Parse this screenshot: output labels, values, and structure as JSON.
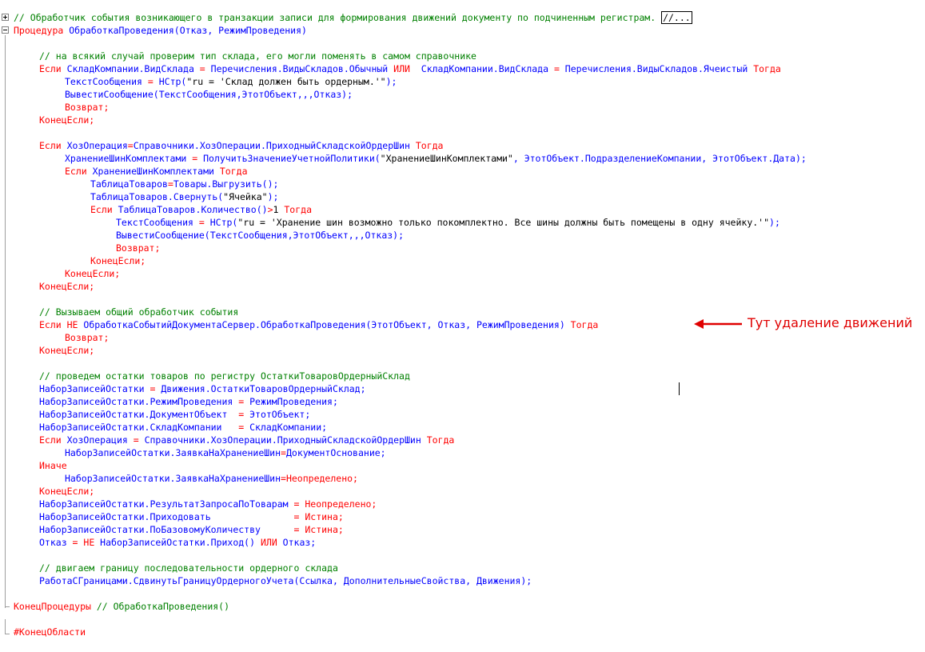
{
  "colors": {
    "keyword": "#ff0000",
    "comment": "#008000",
    "identifier": "#0000ff",
    "string": "#000000",
    "annotation": "#e00000"
  },
  "code": {
    "lines": [
      {
        "indent": 0,
        "tokens": [
          {
            "t": "// Обработчик события возникающего в транзакции записи для формирования движений документу по подчиненным регистрам. ",
            "c": "c"
          },
          {
            "t": "//...",
            "c": "fold"
          }
        ]
      },
      {
        "indent": 0,
        "tokens": [
          {
            "t": "Процедура",
            "c": "k"
          },
          {
            "t": " ОбработкаПроведения(Отказ, РежимПроведения)",
            "c": "i"
          }
        ]
      },
      {
        "indent": 0,
        "tokens": []
      },
      {
        "indent": 1,
        "tokens": [
          {
            "t": "// на всякий случай проверим тип склада, его могли поменять в самом справочнике",
            "c": "c"
          }
        ]
      },
      {
        "indent": 1,
        "tokens": [
          {
            "t": "Если",
            "c": "k"
          },
          {
            "t": " СкладКомпании.ВидСклада ",
            "c": "i"
          },
          {
            "t": "=",
            "c": "k"
          },
          {
            "t": " Перечисления.ВидыСкладов.Обычный ",
            "c": "i"
          },
          {
            "t": "ИЛИ",
            "c": "k"
          },
          {
            "t": "  СкладКомпании.ВидСклада ",
            "c": "i"
          },
          {
            "t": "=",
            "c": "k"
          },
          {
            "t": " Перечисления.ВидыСкладов.Ячеистый ",
            "c": "i"
          },
          {
            "t": "Тогда",
            "c": "k"
          }
        ]
      },
      {
        "indent": 2,
        "tokens": [
          {
            "t": "ТекстСообщения ",
            "c": "i"
          },
          {
            "t": "=",
            "c": "k"
          },
          {
            "t": " НСтр(",
            "c": "i"
          },
          {
            "t": "\"ru = 'Склад должен быть ордерным.'\"",
            "c": "s"
          },
          {
            "t": ");",
            "c": "i"
          }
        ]
      },
      {
        "indent": 2,
        "tokens": [
          {
            "t": "ВывестиСообщение(ТекстСообщения,ЭтотОбъект,,,Отказ);",
            "c": "i"
          }
        ]
      },
      {
        "indent": 2,
        "tokens": [
          {
            "t": "Возврат;",
            "c": "k"
          }
        ]
      },
      {
        "indent": 1,
        "tokens": [
          {
            "t": "КонецЕсли;",
            "c": "k"
          }
        ]
      },
      {
        "indent": 0,
        "tokens": []
      },
      {
        "indent": 1,
        "tokens": [
          {
            "t": "Если",
            "c": "k"
          },
          {
            "t": " ХозОперация",
            "c": "i"
          },
          {
            "t": "=",
            "c": "k"
          },
          {
            "t": "Справочники.ХозОперации.ПриходныйСкладскойОрдерШин ",
            "c": "i"
          },
          {
            "t": "Тогда",
            "c": "k"
          }
        ]
      },
      {
        "indent": 2,
        "tokens": [
          {
            "t": "ХранениеШинКомплектами ",
            "c": "i"
          },
          {
            "t": "=",
            "c": "k"
          },
          {
            "t": " ПолучитьЗначениеУчетнойПолитики(",
            "c": "i"
          },
          {
            "t": "\"ХранениеШинКомплектами\"",
            "c": "s"
          },
          {
            "t": ", ЭтотОбъект.ПодразделениеКомпании, ЭтотОбъект.Дата);",
            "c": "i"
          }
        ]
      },
      {
        "indent": 2,
        "tokens": [
          {
            "t": "Если",
            "c": "k"
          },
          {
            "t": " ХранениеШинКомплектами ",
            "c": "i"
          },
          {
            "t": "Тогда",
            "c": "k"
          }
        ]
      },
      {
        "indent": 3,
        "tokens": [
          {
            "t": "ТаблицаТоваров",
            "c": "i"
          },
          {
            "t": "=",
            "c": "k"
          },
          {
            "t": "Товары.Выгрузить();",
            "c": "i"
          }
        ]
      },
      {
        "indent": 3,
        "tokens": [
          {
            "t": "ТаблицаТоваров.Свернуть(",
            "c": "i"
          },
          {
            "t": "\"Ячейка\"",
            "c": "s"
          },
          {
            "t": ");",
            "c": "i"
          }
        ]
      },
      {
        "indent": 3,
        "tokens": [
          {
            "t": "Если",
            "c": "k"
          },
          {
            "t": " ТаблицаТоваров.Количество()",
            "c": "i"
          },
          {
            "t": ">",
            "c": "k"
          },
          {
            "t": "1 ",
            "c": "s"
          },
          {
            "t": "Тогда",
            "c": "k"
          }
        ]
      },
      {
        "indent": 4,
        "tokens": [
          {
            "t": "ТекстСообщения ",
            "c": "i"
          },
          {
            "t": "=",
            "c": "k"
          },
          {
            "t": " НСтр(",
            "c": "i"
          },
          {
            "t": "\"ru = 'Хранение шин возможно только покомплектно. Все шины должны быть помещены в одну ячейку.'\"",
            "c": "s"
          },
          {
            "t": ");",
            "c": "i"
          }
        ]
      },
      {
        "indent": 4,
        "tokens": [
          {
            "t": "ВывестиСообщение(ТекстСообщения,ЭтотОбъект,,,Отказ);",
            "c": "i"
          }
        ]
      },
      {
        "indent": 4,
        "tokens": [
          {
            "t": "Возврат;",
            "c": "k"
          }
        ]
      },
      {
        "indent": 3,
        "tokens": [
          {
            "t": "КонецЕсли;",
            "c": "k"
          }
        ]
      },
      {
        "indent": 2,
        "tokens": [
          {
            "t": "КонецЕсли;",
            "c": "k"
          }
        ]
      },
      {
        "indent": 1,
        "tokens": [
          {
            "t": "КонецЕсли;",
            "c": "k"
          }
        ]
      },
      {
        "indent": 0,
        "tokens": []
      },
      {
        "indent": 1,
        "tokens": [
          {
            "t": "// Вызываем общий обработчик события",
            "c": "c"
          }
        ]
      },
      {
        "indent": 1,
        "tokens": [
          {
            "t": "Если НЕ",
            "c": "k"
          },
          {
            "t": " ОбработкаСобытийДокументаСервер.ОбработкаПроведения(ЭтотОбъект, Отказ, РежимПроведения) ",
            "c": "i"
          },
          {
            "t": "Тогда",
            "c": "k"
          }
        ]
      },
      {
        "indent": 2,
        "tokens": [
          {
            "t": "Возврат;",
            "c": "k"
          }
        ]
      },
      {
        "indent": 1,
        "tokens": [
          {
            "t": "КонецЕсли;",
            "c": "k"
          }
        ]
      },
      {
        "indent": 0,
        "tokens": []
      },
      {
        "indent": 1,
        "tokens": [
          {
            "t": "// проведем остатки товаров по регистру ОстаткиТоваровОрдерныйСклад",
            "c": "c"
          }
        ]
      },
      {
        "indent": 1,
        "tokens": [
          {
            "t": "НаборЗаписейОстатки ",
            "c": "i"
          },
          {
            "t": "=",
            "c": "k"
          },
          {
            "t": " Движения.ОстаткиТоваровОрдерныйСклад;",
            "c": "i"
          }
        ]
      },
      {
        "indent": 1,
        "tokens": [
          {
            "t": "НаборЗаписейОстатки.РежимПроведения ",
            "c": "i"
          },
          {
            "t": "=",
            "c": "k"
          },
          {
            "t": " РежимПроведения;",
            "c": "i"
          }
        ]
      },
      {
        "indent": 1,
        "tokens": [
          {
            "t": "НаборЗаписейОстатки.ДокументОбъект  ",
            "c": "i"
          },
          {
            "t": "=",
            "c": "k"
          },
          {
            "t": " ЭтотОбъект;",
            "c": "i"
          }
        ]
      },
      {
        "indent": 1,
        "tokens": [
          {
            "t": "НаборЗаписейОстатки.СкладКомпании   ",
            "c": "i"
          },
          {
            "t": "=",
            "c": "k"
          },
          {
            "t": " СкладКомпании;",
            "c": "i"
          }
        ]
      },
      {
        "indent": 1,
        "tokens": [
          {
            "t": "Если",
            "c": "k"
          },
          {
            "t": " ХозОперация ",
            "c": "i"
          },
          {
            "t": "=",
            "c": "k"
          },
          {
            "t": " Справочники.ХозОперации.ПриходныйСкладскойОрдерШин ",
            "c": "i"
          },
          {
            "t": "Тогда",
            "c": "k"
          }
        ]
      },
      {
        "indent": 2,
        "tokens": [
          {
            "t": "НаборЗаписейОстатки.ЗаявкаНаХранениеШин",
            "c": "i"
          },
          {
            "t": "=",
            "c": "k"
          },
          {
            "t": "ДокументОснование;",
            "c": "i"
          }
        ]
      },
      {
        "indent": 1,
        "tokens": [
          {
            "t": "Иначе",
            "c": "k"
          }
        ]
      },
      {
        "indent": 2,
        "tokens": [
          {
            "t": "НаборЗаписейОстатки.ЗаявкаНаХранениеШин",
            "c": "i"
          },
          {
            "t": "=Неопределено;",
            "c": "k"
          }
        ]
      },
      {
        "indent": 1,
        "tokens": [
          {
            "t": "КонецЕсли;",
            "c": "k"
          }
        ]
      },
      {
        "indent": 1,
        "tokens": [
          {
            "t": "НаборЗаписейОстатки.РезультатЗапросаПоТоварам ",
            "c": "i"
          },
          {
            "t": "= Неопределено;",
            "c": "k"
          }
        ]
      },
      {
        "indent": 1,
        "tokens": [
          {
            "t": "НаборЗаписейОстатки.Приходовать               ",
            "c": "i"
          },
          {
            "t": "= Истина;",
            "c": "k"
          }
        ]
      },
      {
        "indent": 1,
        "tokens": [
          {
            "t": "НаборЗаписейОстатки.ПоБазовомуКоличеству      ",
            "c": "i"
          },
          {
            "t": "= Истина;",
            "c": "k"
          }
        ]
      },
      {
        "indent": 1,
        "tokens": [
          {
            "t": "Отказ ",
            "c": "i"
          },
          {
            "t": "= НЕ",
            "c": "k"
          },
          {
            "t": " НаборЗаписейОстатки.Приход() ",
            "c": "i"
          },
          {
            "t": "ИЛИ",
            "c": "k"
          },
          {
            "t": " Отказ;",
            "c": "i"
          }
        ]
      },
      {
        "indent": 0,
        "tokens": []
      },
      {
        "indent": 1,
        "tokens": [
          {
            "t": "// двигаем границу последовательности ордерного склада",
            "c": "c"
          }
        ]
      },
      {
        "indent": 1,
        "tokens": [
          {
            "t": "РаботаСГраницами.СдвинутьГраницуОрдерногоУчета(Ссылка, ДополнительныеСвойства, Движения);",
            "c": "i"
          }
        ]
      },
      {
        "indent": 0,
        "tokens": []
      },
      {
        "indent": 0,
        "tokens": [
          {
            "t": "КонецПроцедуры",
            "c": "k"
          },
          {
            "t": " // ОбработкаПроведения()",
            "c": "c"
          }
        ]
      },
      {
        "indent": 0,
        "tokens": []
      },
      {
        "indent": 0,
        "tokens": [
          {
            "t": "#КонецОбласти",
            "c": "k"
          }
        ]
      }
    ]
  },
  "annotation": {
    "text": "Тут удаление движений"
  }
}
